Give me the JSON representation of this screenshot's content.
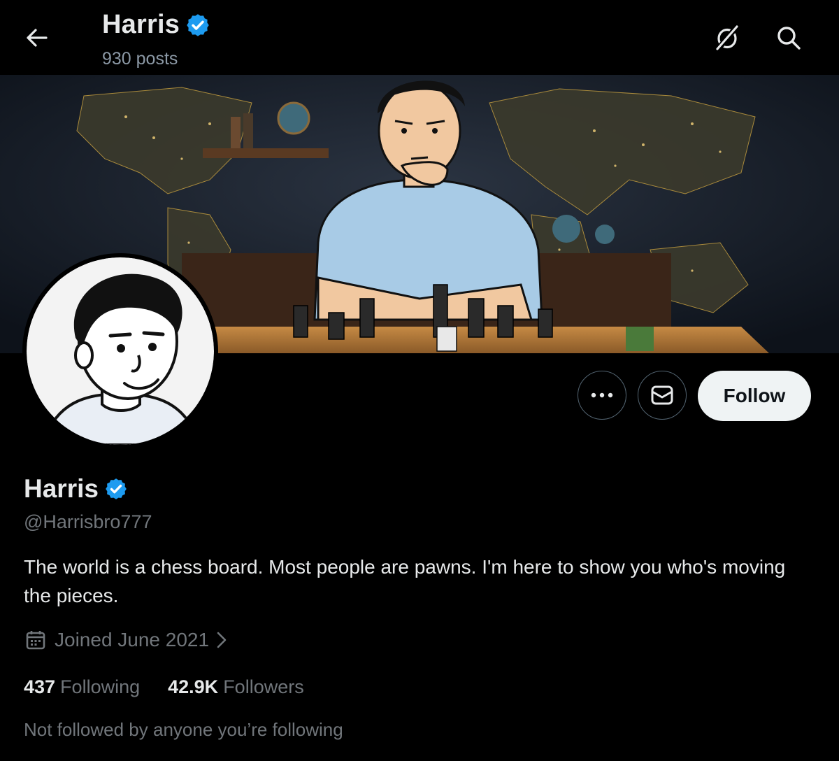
{
  "header": {
    "name": "Harris",
    "posts": "930 posts",
    "icons": [
      "back-arrow-icon",
      "grok-icon",
      "search-icon"
    ]
  },
  "actions": {
    "more_icon": "more-horizontal-icon",
    "message_icon": "mail-icon",
    "follow_label": "Follow"
  },
  "profile": {
    "name": "Harris",
    "handle": "@Harrisbro777",
    "bio": "The world is a chess board. Most people are pawns. I'm here to show you who's moving the pieces.",
    "joined": "Joined June 2021",
    "following_count": "437",
    "following_label": "Following",
    "followers_count": "42.9K",
    "followers_label": "Followers",
    "not_followed": "Not followed by anyone you’re following"
  },
  "colors": {
    "background": "#000000",
    "verified": "#1d9bf0",
    "text_primary": "#e7e9ea",
    "text_secondary": "#71767b",
    "follow_button": "#eff3f4"
  }
}
